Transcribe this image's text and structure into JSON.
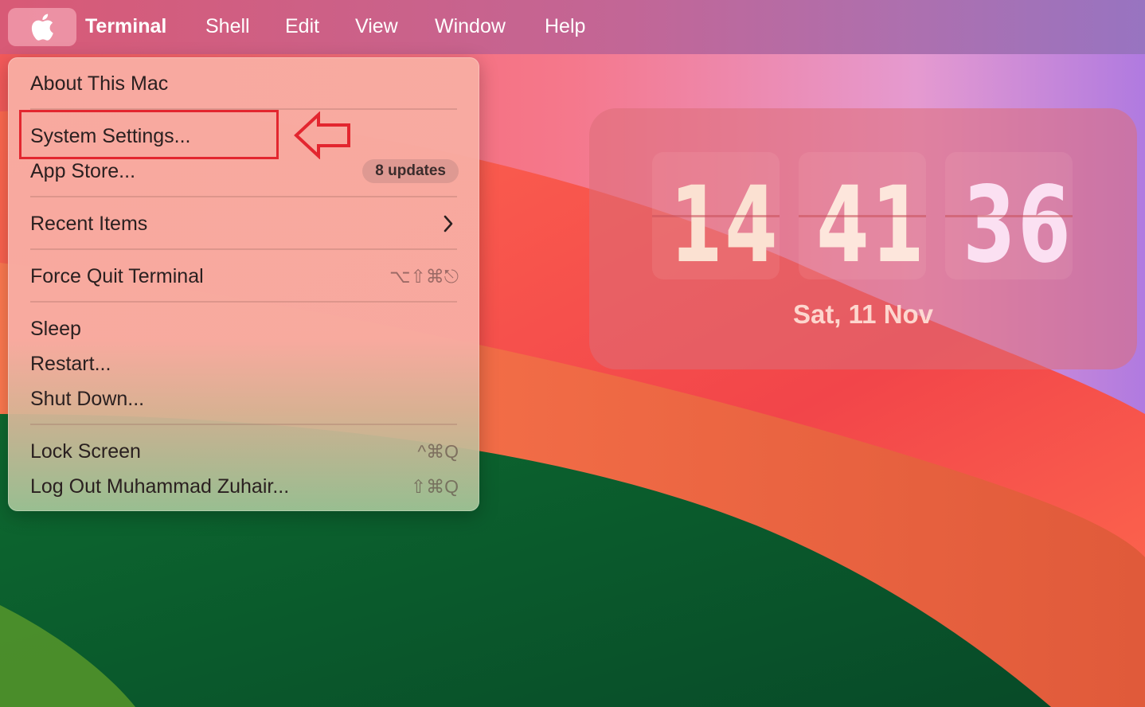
{
  "menubar": {
    "app_name": "Terminal",
    "items": [
      "Shell",
      "Edit",
      "View",
      "Window",
      "Help"
    ]
  },
  "apple_menu": {
    "about": "About This Mac",
    "system_settings": "System Settings...",
    "app_store": "App Store...",
    "app_store_badge": "8 updates",
    "recent_items": "Recent Items",
    "force_quit": "Force Quit Terminal",
    "force_quit_shortcut": "⌥⇧⌘⎋",
    "sleep": "Sleep",
    "restart": "Restart...",
    "shut_down": "Shut Down...",
    "lock_screen": "Lock Screen",
    "lock_screen_shortcut": "^⌘Q",
    "log_out": "Log Out Muhammad Zuhair...",
    "log_out_shortcut": "⇧⌘Q"
  },
  "clock": {
    "hours": "14",
    "minutes": "41",
    "seconds": "36",
    "date": "Sat, 11 Nov"
  },
  "colors": {
    "highlight": "#e3262f",
    "hours_digits": "#fbe1d2",
    "minutes_digits": "#fde6dc",
    "seconds_digits": "#fbe0f2"
  }
}
